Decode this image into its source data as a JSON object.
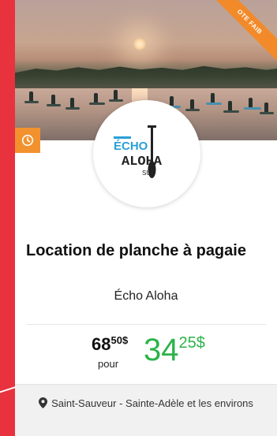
{
  "ribbon_label": "OTE FAIB",
  "logo": {
    "line1": "ÉCHO",
    "line2": "ALOHA",
    "line3": "SUP",
    "primary_color": "#2a9fd6",
    "dark_color": "#222222"
  },
  "title": "Location de planche à pagaie",
  "vendor": "Écho Aloha",
  "pricing": {
    "old_int": "68",
    "old_dec": "50$",
    "pour": "pour",
    "new_int": "34",
    "new_dec": "25$",
    "new_color": "#2bb34a"
  },
  "location": "Saint-Sauveur - Sainte-Adèle et les environs",
  "colors": {
    "background": "#e8323e",
    "ribbon": "#f28a2a",
    "clock_tab": "#f2922e"
  },
  "icons": {
    "clock": "clock-icon",
    "pin": "map-pin-icon"
  }
}
